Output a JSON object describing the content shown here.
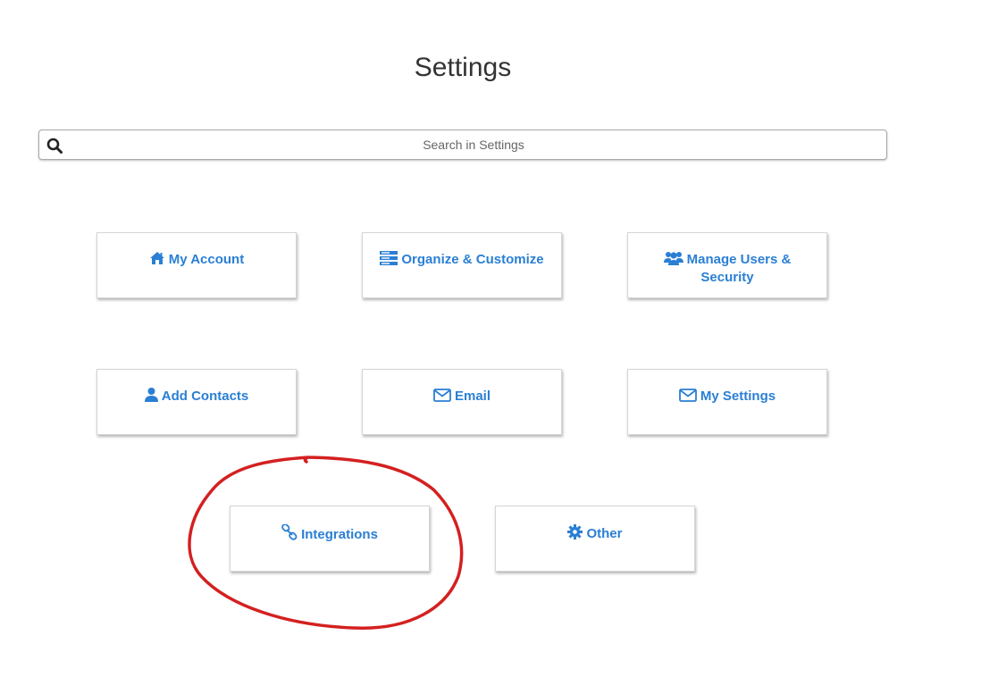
{
  "page": {
    "title": "Settings"
  },
  "search": {
    "placeholder": "Search in Settings"
  },
  "colors": {
    "accent": "#2a7fd4",
    "annotation": "#d42020"
  },
  "cards": [
    {
      "label": "My Account",
      "icon": "home-icon"
    },
    {
      "label": "Organize & Customize",
      "icon": "server-icon"
    },
    {
      "label": "Manage Users & Security",
      "icon": "users-icon"
    },
    {
      "label": "Add Contacts",
      "icon": "user-icon"
    },
    {
      "label": "Email",
      "icon": "envelope-icon"
    },
    {
      "label": "My Settings",
      "icon": "envelope-icon"
    },
    {
      "label": "Integrations",
      "icon": "link-icon"
    },
    {
      "label": "Other",
      "icon": "gear-icon"
    }
  ]
}
